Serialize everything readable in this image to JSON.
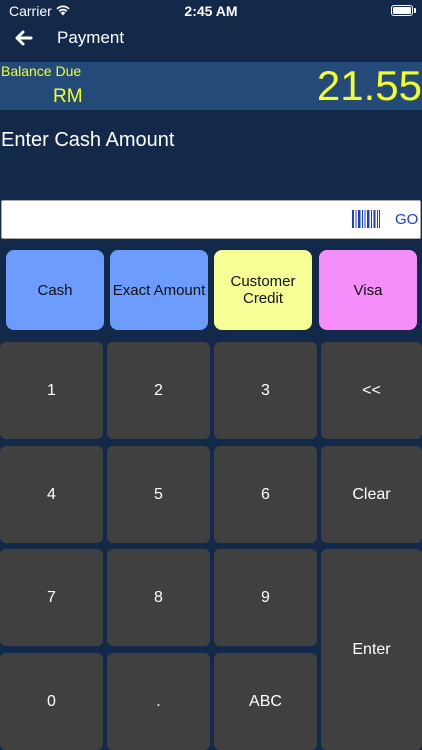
{
  "status_bar": {
    "carrier": "Carrier",
    "time": "2:45 AM"
  },
  "nav": {
    "title": "Payment",
    "back_icon": "arrow-left-icon"
  },
  "balance": {
    "label": "Balance Due",
    "currency": "RM",
    "amount": "21.55"
  },
  "prompt": "Enter Cash Amount",
  "cash_input": {
    "value": "",
    "placeholder": "",
    "go_label": "GO",
    "barcode_icon": "barcode-icon"
  },
  "payment_methods": [
    {
      "label": "Cash",
      "color": "#6d9cff"
    },
    {
      "label": "Exact Amount",
      "color": "#6d9cff"
    },
    {
      "label": "Customer Credit",
      "color": "#f5ff96"
    },
    {
      "label": "Visa",
      "color": "#f58dfa"
    }
  ],
  "keypad": {
    "k1": "1",
    "k2": "2",
    "k3": "3",
    "backspace": "<<",
    "k4": "4",
    "k5": "5",
    "k6": "6",
    "clear": "Clear",
    "k7": "7",
    "k8": "8",
    "k9": "9",
    "enter": "Enter",
    "k0": "0",
    "dot": ".",
    "abc": "ABC"
  },
  "colors": {
    "background": "#13294a",
    "balance_panel": "#244a7a",
    "balance_text": "#f2ff2b",
    "key": "#404040",
    "go_text": "#1a3fc4"
  }
}
